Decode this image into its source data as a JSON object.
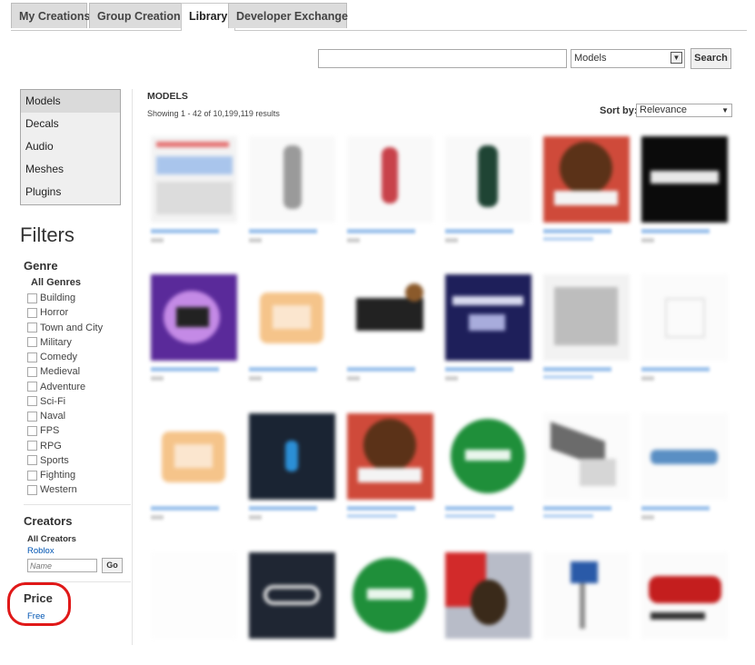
{
  "tabs": [
    {
      "label": "My Creations",
      "active": false
    },
    {
      "label": "Group Creations",
      "active": false
    },
    {
      "label": "Library",
      "active": true
    },
    {
      "label": "Developer Exchange",
      "active": false
    }
  ],
  "search": {
    "value": "",
    "category_selected": "Models",
    "button_label": "Search"
  },
  "sidebar": {
    "items": [
      "Models",
      "Decals",
      "Audio",
      "Meshes",
      "Plugins"
    ],
    "active": "Models"
  },
  "filters": {
    "title": "Filters",
    "genre_title": "Genre",
    "genre_all": "All Genres",
    "genres": [
      "Building",
      "Horror",
      "Town and City",
      "Military",
      "Comedy",
      "Medieval",
      "Adventure",
      "Sci-Fi",
      "Naval",
      "FPS",
      "RPG",
      "Sports",
      "Fighting",
      "Western"
    ],
    "creators_title": "Creators",
    "creators_all": "All Creators",
    "creators_roblox": "Roblox",
    "name_placeholder": "Name",
    "go_label": "Go",
    "price_title": "Price",
    "price_free": "Free"
  },
  "results": {
    "title": "MODELS",
    "showing": "Showing 1 - 42 of 10,199,119 results",
    "sort_label": "Sort by:",
    "sort_value": "Relevance"
  },
  "colors": {
    "link": "#0055b3",
    "highlight_circle": "#e01818"
  }
}
